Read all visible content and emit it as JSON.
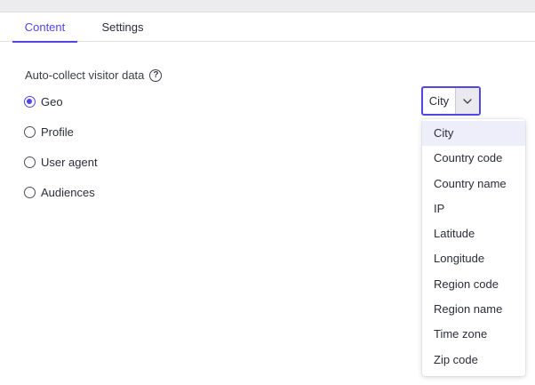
{
  "tabs": [
    {
      "label": "Content",
      "active": true
    },
    {
      "label": "Settings",
      "active": false
    }
  ],
  "section": {
    "label": "Auto-collect visitor data",
    "help_icon": "question-circle-icon"
  },
  "radios": [
    {
      "label": "Geo",
      "checked": true
    },
    {
      "label": "Profile",
      "checked": false
    },
    {
      "label": "User agent",
      "checked": false
    },
    {
      "label": "Audiences",
      "checked": false
    }
  ],
  "select": {
    "value": "City",
    "chevron_icon": "chevron-down-icon"
  },
  "dropdown": {
    "options": [
      "City",
      "Country code",
      "Country name",
      "IP",
      "Latitude",
      "Longitude",
      "Region code",
      "Region name",
      "Time zone",
      "Zip code"
    ],
    "selected_index": 0
  },
  "colors": {
    "accent": "#4f46e5",
    "selected_bg": "#eeeefa"
  }
}
